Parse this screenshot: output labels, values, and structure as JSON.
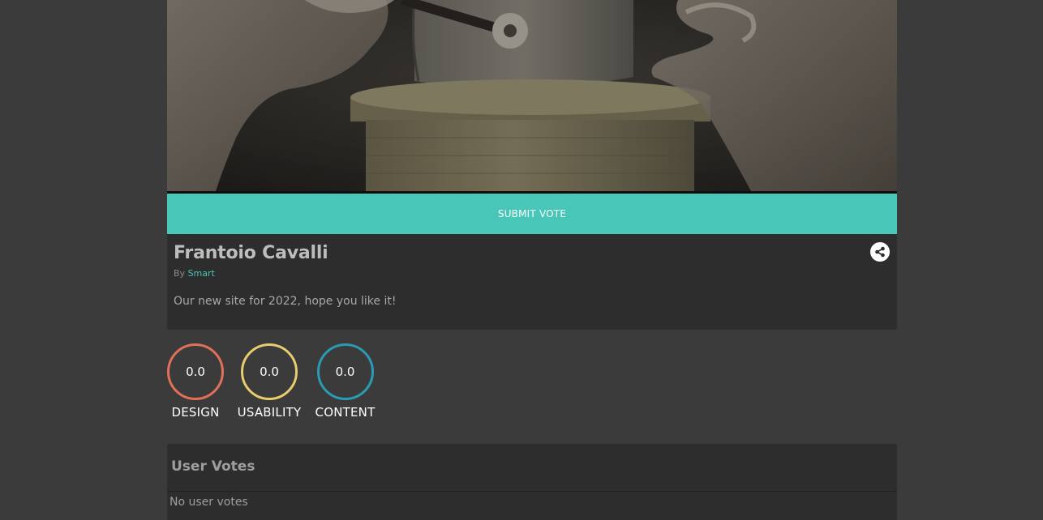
{
  "hero": {
    "image_alt": "Sculpture of horses turning an olive mill stone"
  },
  "submit_button": {
    "label": "SUBMIT VOTE"
  },
  "site": {
    "title": "Frantoio Cavalli",
    "by_prefix": "By",
    "author": "Smart",
    "description": "Our new site for 2022, hope you like it!"
  },
  "share": {
    "icon": "share-icon"
  },
  "scores": [
    {
      "value": "0.0",
      "label": "DESIGN",
      "color": "#e07058"
    },
    {
      "value": "0.0",
      "label": "USABILITY",
      "color": "#e8cc6e"
    },
    {
      "value": "0.0",
      "label": "CONTENT",
      "color": "#2a9bb3"
    }
  ],
  "user_votes": {
    "title": "User Votes",
    "empty_text": "No user votes"
  },
  "colors": {
    "page_bg": "#3b3b3b",
    "card_bg": "#2d2d2d",
    "accent": "#48c6b8"
  }
}
